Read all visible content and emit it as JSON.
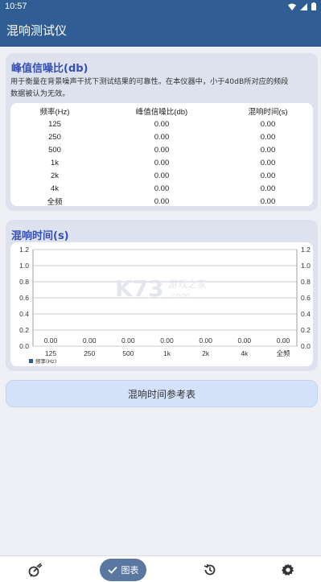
{
  "status_bar": {
    "time": "10:57"
  },
  "app_bar": {
    "title": "混响测试仪"
  },
  "peak_section": {
    "title": "峰值信噪比(db)",
    "description_lines": [
      "用于衡量在背景噪声干扰下测试结果的可靠性。在本仪器中，小于40dB所对应的频段",
      "数据被认为无效。"
    ],
    "headers": [
      "频率(Hz)",
      "峰值信噪比(db)",
      "混响时间(s)"
    ],
    "rows": [
      [
        "125",
        "0.00",
        "0.00"
      ],
      [
        "250",
        "0.00",
        "0.00"
      ],
      [
        "500",
        "0.00",
        "0.00"
      ],
      [
        "1k",
        "0.00",
        "0.00"
      ],
      [
        "2k",
        "0.00",
        "0.00"
      ],
      [
        "4k",
        "0.00",
        "0.00"
      ],
      [
        "全频",
        "0.00",
        "0.00"
      ]
    ]
  },
  "reverb_section": {
    "title": "混响时间(s)"
  },
  "chart_data": {
    "type": "bar",
    "categories": [
      "125",
      "250",
      "500",
      "1k",
      "2k",
      "4k",
      "全频"
    ],
    "values": [
      0,
      0,
      0,
      0,
      0,
      0,
      0
    ],
    "value_labels": [
      "0.00",
      "0.00",
      "0.00",
      "0.00",
      "0.00",
      "0.00",
      "0.00"
    ],
    "ylim": [
      0,
      1.2
    ],
    "yticks": [
      "0.0",
      "0.2",
      "0.4",
      "0.6",
      "0.8",
      "1.0",
      "1.2"
    ],
    "legend": "频率(Hz)",
    "legend_position": "bottom-left",
    "grid": true,
    "bar_color": "#2f5d94"
  },
  "watermark": {
    "text1": "K73",
    "text2": "游戏之家",
    "text3": ".com"
  },
  "reference_button": {
    "label": "混响时间参考表"
  },
  "bottom_nav": {
    "chart_label": "图表"
  },
  "colors": {
    "primary": "#2f5d94",
    "accent": "#3550b2",
    "card": "#dde2ee"
  }
}
